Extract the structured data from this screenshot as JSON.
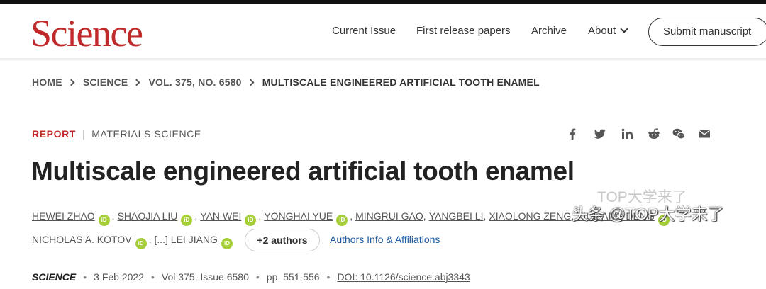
{
  "header": {
    "logo": "Science",
    "nav": [
      "Current Issue",
      "First release papers",
      "Archive",
      "About"
    ],
    "submit_label": "Submit manuscript"
  },
  "breadcrumb": [
    "HOME",
    "SCIENCE",
    "VOL. 375, NO. 6580",
    "MULTISCALE ENGINEERED ARTIFICIAL TOOTH ENAMEL"
  ],
  "article": {
    "type": "REPORT",
    "subject": "MATERIALS SCIENCE",
    "title": "Multiscale engineered artificial tooth enamel",
    "authors": [
      "HEWEI ZHAO",
      "SHAOJIA LIU",
      "YAN WEI",
      "YONGHAI YUE",
      "MINGRUI GAO",
      "YANGBEI LI",
      "XIAOLONG ZENG",
      "XIULIANG DENG",
      "NICHOLAS A. KOTOV",
      "LEI JIANG"
    ],
    "ellipsis": "[...]",
    "more_authors": "+2 authors",
    "affiliations_link": "Authors Info & Affiliations",
    "journal": "SCIENCE",
    "date": "3 Feb 2022",
    "volume": "Vol 375, Issue 6580",
    "pages": "pp. 551-556",
    "doi": "DOI: 10.1126/science.abj3343"
  },
  "share_icons": [
    "facebook-icon",
    "twitter-icon",
    "linkedin-icon",
    "reddit-icon",
    "wechat-icon",
    "email-icon"
  ],
  "orcid_label": "iD",
  "watermark": {
    "line1": "TOP大学来了",
    "line2": "头条 @TOP大学来了"
  },
  "colors": {
    "brand_red": "#c02a2a",
    "orcid_green": "#a6ce39",
    "link_blue": "#1e5a9e",
    "top_bar": "#111111"
  }
}
